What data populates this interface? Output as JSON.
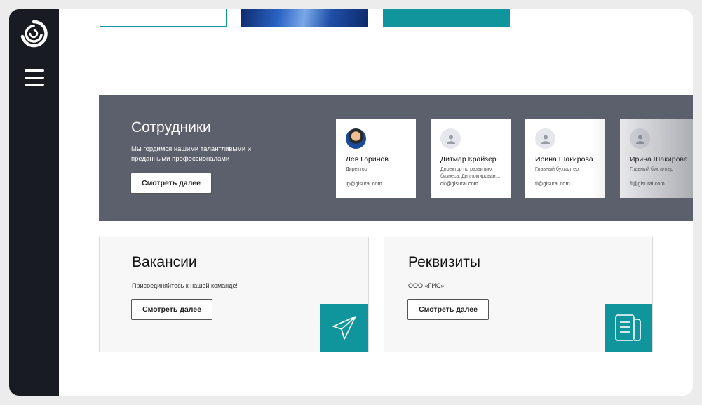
{
  "employees_section": {
    "title": "Сотрудники",
    "description": "Мы гордимся нашими талантливыми и преданными профессионалами",
    "button": "Смотреть далее",
    "people": [
      {
        "name": "Лев Горинов",
        "role": "Директор",
        "email": "lg@gisural.com"
      },
      {
        "name": "Дитмар Крайзер",
        "role": "Директор по развитию бизнеса, Дипломирован…",
        "email": "dk@gisural.com"
      },
      {
        "name": "Ирина Шакирова",
        "role": "Главный бухгалтер",
        "email": "fi@gisural.com"
      },
      {
        "name": "Ирина Шакирова",
        "role": "Главный бухгалтер",
        "email": "fi@gisural.com"
      }
    ]
  },
  "vacancies": {
    "title": "Вакансии",
    "description": "Присоединяйтесь к нашей команде!",
    "button": "Смотреть далее"
  },
  "requisites": {
    "title": "Реквизиты",
    "description": "ООО «ГИС»",
    "button": "Смотреть далее"
  },
  "colors": {
    "sidebar": "#181c22",
    "accent": "#0f959b",
    "band": "#5c5f6c"
  },
  "icons": {
    "logo": "swirl-logo-icon",
    "menu": "hamburger-menu-icon",
    "vacancies": "paper-plane-icon",
    "requisites": "document-icon"
  }
}
